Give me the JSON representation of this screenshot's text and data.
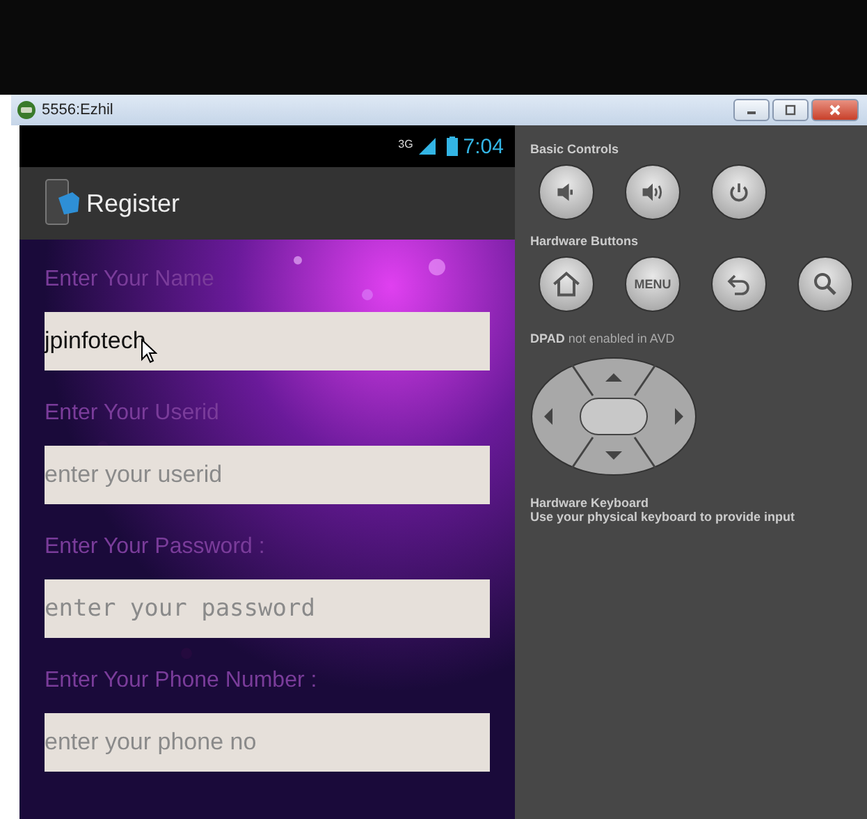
{
  "window": {
    "title": "5556:Ezhil"
  },
  "status_bar": {
    "network": "3G",
    "time": "7:04"
  },
  "action_bar": {
    "title": "Register"
  },
  "form": [
    {
      "label": "Enter Your Name",
      "kind": "text",
      "value": "jpinfotech"
    },
    {
      "label": "Enter Your Userid",
      "kind": "text",
      "placeholder": "enter your userid"
    },
    {
      "label": "Enter Your Password :",
      "kind": "password",
      "placeholder": "enter your password"
    },
    {
      "label": "Enter Your Phone Number :",
      "kind": "text",
      "placeholder": "enter your phone no"
    }
  ],
  "controls": {
    "basic_title": "Basic Controls",
    "basic": [
      {
        "kind": "volume-down"
      },
      {
        "kind": "volume-up"
      },
      {
        "kind": "power"
      }
    ],
    "hardware_title": "Hardware Buttons",
    "hardware": [
      {
        "kind": "home"
      },
      {
        "kind": "menu",
        "label": "MENU"
      },
      {
        "kind": "back"
      },
      {
        "kind": "search"
      }
    ],
    "dpad_note": "**DPAD** not enabled in AVD",
    "keyboard_title": "Hardware Keyboard",
    "keyboard_note": "Use your physical keyboard to provide input"
  }
}
